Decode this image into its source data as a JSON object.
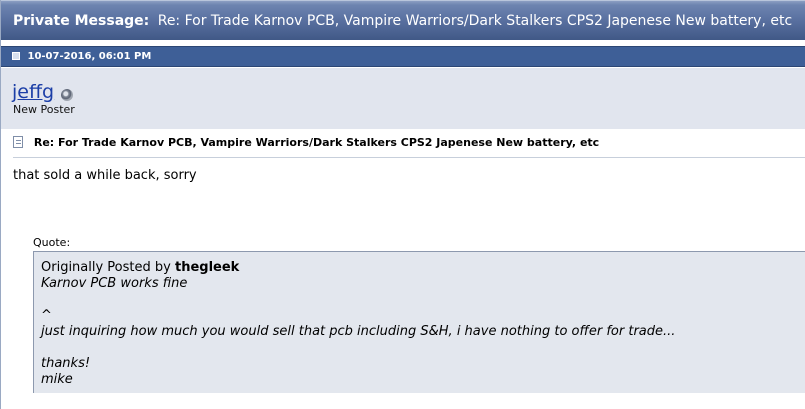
{
  "header": {
    "prefix": "Private Message:",
    "title": "Re: For Trade Karnov PCB, Vampire Warriors/Dark Stalkers CPS2 Japenese New battery, etc"
  },
  "post": {
    "date": "10-07-2016, 06:01 PM",
    "username": "jeffg",
    "user_title": "New Poster",
    "message_title": "Re: For Trade Karnov PCB, Vampire Warriors/Dark Stalkers CPS2 Japenese New battery, etc",
    "body": "that sold a while back, sorry"
  },
  "quote": {
    "label": "Quote:",
    "originally_posted_by": "Originally Posted by",
    "author": "thegleek",
    "line1": "Karnov PCB works fine",
    "line2": "^",
    "line3": "just inquiring how much you would sell that pcb including S&H, i have nothing to offer for trade...",
    "line4": "thanks!",
    "line5": "mike"
  },
  "colors": {
    "header_bg": "#586f9f",
    "date_bar_bg": "#3e5f97",
    "user_panel_bg": "#e1e5ee",
    "username_color": "#1b3ea7",
    "quote_bg": "#e3e7ee"
  },
  "icons": {
    "post": "post-icon",
    "status": "offline-status-icon",
    "message": "document-icon"
  }
}
